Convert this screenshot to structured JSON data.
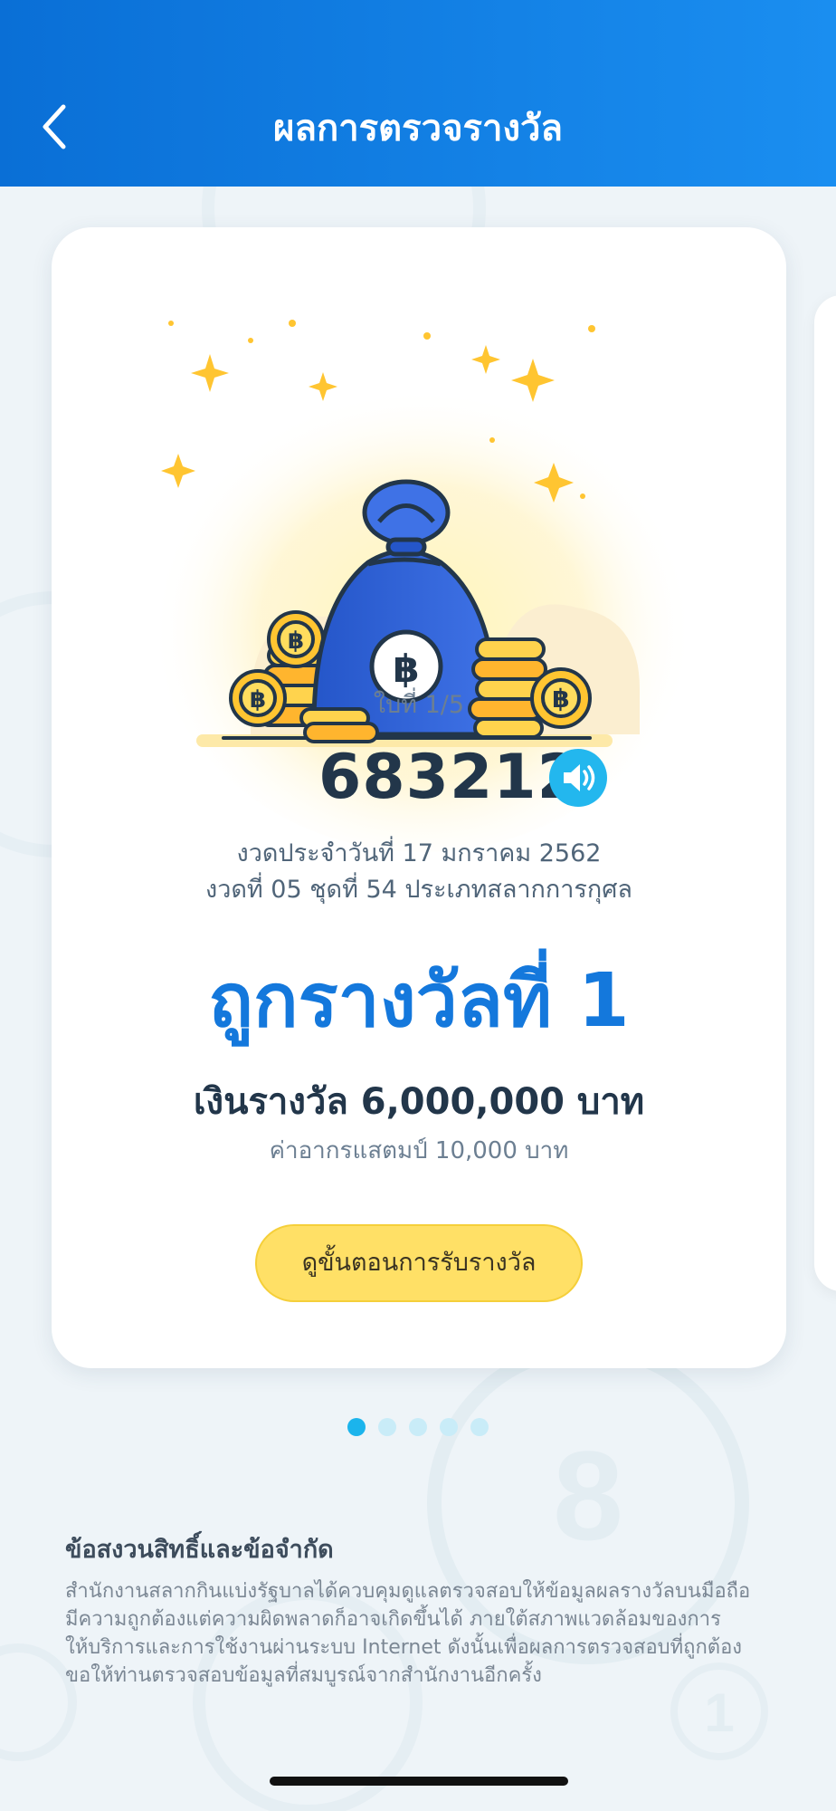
{
  "header": {
    "title": "ผลการตรวจรางวัล",
    "back_icon": "chevron-left-icon"
  },
  "card": {
    "illustration": "money-bag-with-coins",
    "ticket_index": "ใบที่ 1/5",
    "ticket_number": "683212",
    "speaker_icon": "speaker-icon",
    "draw_date": "งวดประจำวันที่ 17 มกราคม 2562",
    "draw_info": "งวดที่ 05  ชุดที่ 54  ประเภทสลากการกุศล",
    "prize_title": "ถูกรางวัลที่ 1",
    "prize_amount": "เงินรางวัล 6,000,000 บาท",
    "stamp_duty": "ค่าอากรแสตมป์ 10,000 บาท",
    "claim_button": "ดูขั้นตอนการรับรางวัล"
  },
  "pagination": {
    "total": 5,
    "active_index": 0
  },
  "disclaimer": {
    "title": "ข้อสงวนสิทธิ์และข้อจำกัด",
    "lines": [
      "สำนักงานสลากกินแบ่งรัฐบาลได้ควบคุมดูแลตรวจสอบให้ข้อมูลผลรางวัลบนมือถือ",
      "มีความถูกต้องแต่ความผิดพลาดก็อาจเกิดขึ้นได้ ภายใต้สภาพแวดล้อมของการ",
      "ให้บริการและการใช้งานผ่านระบบ Internet ดังนั้นเพื่อผลการตรวจสอบที่ถูกต้อง",
      "ขอให้ท่านตรวจสอบข้อมูลที่สมบูรณ์จากสำนักงานอีกครั้ง"
    ]
  },
  "colors": {
    "header_start": "#0a6fd6",
    "header_end": "#1a8ef0",
    "prize_blue": "#1478dc",
    "button_yellow": "#ffe066",
    "dot_active": "#1bb4ec",
    "dot_inactive": "#c9ecf8"
  }
}
